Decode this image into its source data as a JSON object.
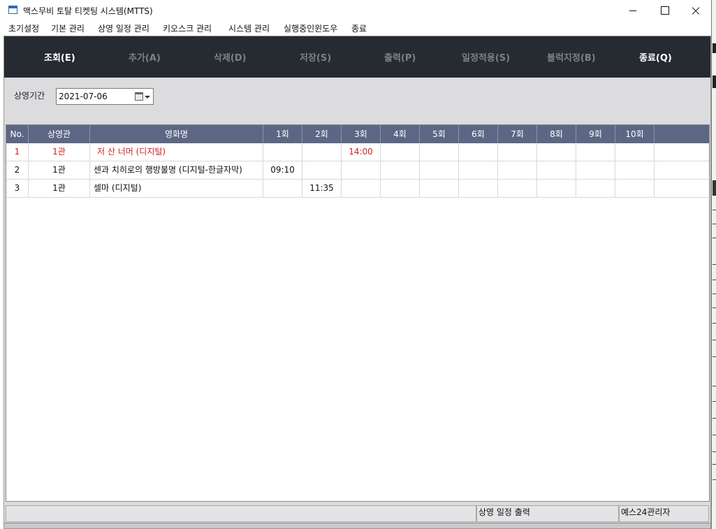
{
  "window": {
    "title": "맥스무비 토탈 티켓팅 시스템(MTTS)"
  },
  "menu": {
    "items": [
      "초기설정",
      "기본 관리",
      "상영 일정 관리",
      "키오스크 관리",
      "시스템 관리",
      "실행중인윈도우",
      "종료"
    ]
  },
  "toolbar": {
    "buttons": [
      {
        "label": "조회(E)",
        "enabled": true
      },
      {
        "label": "추가(A)",
        "enabled": false
      },
      {
        "label": "삭제(D)",
        "enabled": false
      },
      {
        "label": "저장(S)",
        "enabled": false
      },
      {
        "label": "출력(P)",
        "enabled": false
      },
      {
        "label": "일정적용(S)",
        "enabled": false
      },
      {
        "label": "블럭지정(B)",
        "enabled": false
      },
      {
        "label": "종료(Q)",
        "enabled": true
      }
    ]
  },
  "filter": {
    "label": "상영기간",
    "date": "2021-07-06"
  },
  "grid": {
    "columns": [
      "No.",
      "상영관",
      "영화명",
      "1회",
      "2회",
      "3회",
      "4회",
      "5회",
      "6회",
      "7회",
      "8회",
      "9회",
      "10회",
      ""
    ],
    "rows": [
      {
        "no": "1",
        "hall": "1관",
        "title": "저 산 너머 (디지털)",
        "s1": "",
        "s2": "",
        "s3": "14:00",
        "s4": "",
        "s5": "",
        "s6": "",
        "s7": "",
        "s8": "",
        "s9": "",
        "s10": ""
      },
      {
        "no": "2",
        "hall": "1관",
        "title": "센과 치히로의 행방불명 (디지털-한글자막)",
        "s1": "09:10",
        "s2": "",
        "s3": "",
        "s4": "",
        "s5": "",
        "s6": "",
        "s7": "",
        "s8": "",
        "s9": "",
        "s10": ""
      },
      {
        "no": "3",
        "hall": "1관",
        "title": "셀마 (디지털)",
        "s1": "",
        "s2": "11:35",
        "s3": "",
        "s4": "",
        "s5": "",
        "s6": "",
        "s7": "",
        "s8": "",
        "s9": "",
        "s10": ""
      }
    ],
    "highlight_color": "#d01f1f"
  },
  "statusbar": {
    "message": "상영 일정 출력",
    "user": "예스24관리자"
  }
}
